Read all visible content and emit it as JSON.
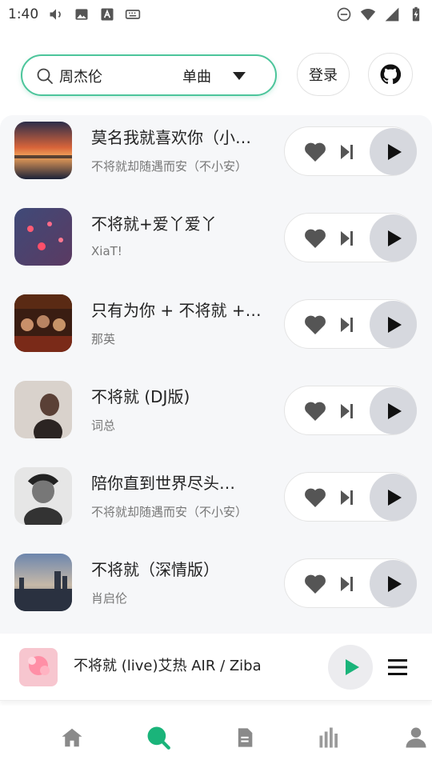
{
  "status_bar": {
    "time": "1:40"
  },
  "search": {
    "value": "周杰伦",
    "type_selected": "单曲"
  },
  "header": {
    "login_label": "登录"
  },
  "songs": [
    {
      "title": "莫名我就喜欢你（小…",
      "artist": "不将就却随遇而安（不小安）"
    },
    {
      "title": "不将就+爱丫爱丫",
      "artist": "XiaT!"
    },
    {
      "title": "只有为你 + 不将就 +…",
      "artist": "那英"
    },
    {
      "title": "不将就 (DJ版)",
      "artist": "词总"
    },
    {
      "title": "陪你直到世界尽头…",
      "artist": "不将就却随遇而安（不小安）"
    },
    {
      "title": "不将就（深情版）",
      "artist": "肖启伦"
    }
  ],
  "player": {
    "now_playing": "不将就 (live)艾热 AIR / Ziba"
  },
  "colors": {
    "accent": "#1ab47a",
    "search_border": "#4cc59b",
    "icon_gray": "#555555",
    "play_bg": "#d6d8de"
  },
  "nav": {
    "active": "search",
    "items": [
      "home-icon",
      "search-icon",
      "document-icon",
      "chart-icon",
      "user-icon"
    ]
  }
}
